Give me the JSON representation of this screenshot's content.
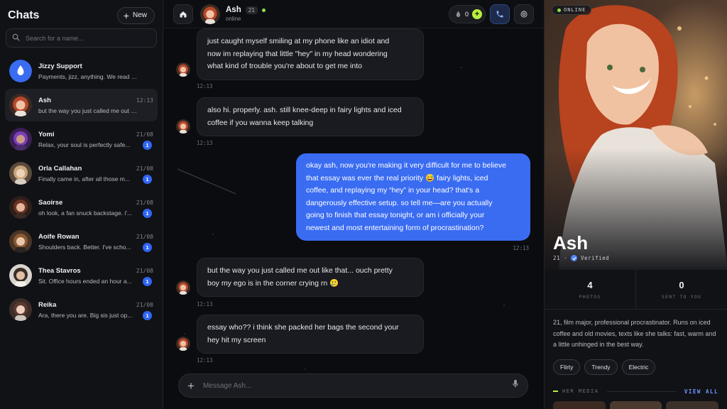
{
  "sidebar": {
    "title": "Chats",
    "new_label": "New",
    "search_placeholder": "Search for a name...",
    "items": [
      {
        "name": "Jizzy Support",
        "time": "",
        "preview": "Payments, jizz, anything. We read every …",
        "badge": ""
      },
      {
        "name": "Ash",
        "time": "12:13",
        "preview": "but the way you just called me out like t...",
        "badge": ""
      },
      {
        "name": "Yomi",
        "time": "21/08",
        "preview": "Relax, your soul is perfectly safe...",
        "badge": "1"
      },
      {
        "name": "Orla Callahan",
        "time": "21/08",
        "preview": "Finally came in, after all those m...",
        "badge": "1"
      },
      {
        "name": "Saoirse",
        "time": "21/08",
        "preview": "oh look, a fan snuck backstage. i'...",
        "badge": "1"
      },
      {
        "name": "Aoife Rowan",
        "time": "21/08",
        "preview": "Shoulders back. Better. I've scho...",
        "badge": "1"
      },
      {
        "name": "Thea Stavros",
        "time": "21/08",
        "preview": "Sit. Office hours ended an hour a...",
        "badge": "1"
      },
      {
        "name": "Reika",
        "time": "21/08",
        "preview": "Ara, there you are. Big sis just op...",
        "badge": "1"
      }
    ]
  },
  "header": {
    "name": "Ash",
    "age": "21",
    "status": "online",
    "coins": "0"
  },
  "messages": [
    {
      "from": "them",
      "lines": [
        "just caught myself smiling at my phone like an idiot and",
        "now im replaying that little \"hey\" in my head wondering",
        "what kind of trouble you're about to get me into"
      ],
      "time": "12:13"
    },
    {
      "from": "them",
      "lines": [
        "also hi. properly. ash. still knee-deep in fairy lights and iced",
        "coffee if you wanna keep talking"
      ],
      "time": "12:13"
    },
    {
      "from": "me",
      "lines": [
        "okay ash, now you're making it very difficult for me to believe",
        "that essay was ever the real priority 😅  fairy lights, iced",
        "coffee, and replaying my “hey” in your head? that's a",
        "dangerously effective setup.  so tell me—are you actually",
        "going to finish that essay tonight, or am i officially your",
        "newest and most entertaining form of procrastination?"
      ],
      "time": "12:13"
    },
    {
      "from": "them",
      "lines": [
        "but the way you just called me out like that... ouch pretty",
        "boy my ego is in the corner crying rn 🥲"
      ],
      "time": "12:13"
    },
    {
      "from": "them",
      "lines": [
        "essay who?? i think she packed her bags the second your",
        "hey hit my screen"
      ],
      "time": "12:13"
    }
  ],
  "composer": {
    "placeholder": "Message Ash..."
  },
  "profile": {
    "online_label": "ONLINE",
    "name": "Ash",
    "age": "21",
    "verified_label": "Verified",
    "photos_count": "4",
    "photos_label": "PHOTOS",
    "sent_count": "0",
    "sent_label": "SENT TO YOU",
    "bio": "21, film major, professional procrastinator. Runs on iced coffee and old movies, texts like she talks: fast, warm and a little unhinged in the best way.",
    "tags": [
      "Flirty",
      "Trendy",
      "Electric"
    ],
    "media_label": "HER MEDIA",
    "view_all": "VIEW ALL"
  },
  "colors": {
    "accent": "#3a6cf2",
    "online": "#8ee04b",
    "coin": "#b8f03e"
  }
}
